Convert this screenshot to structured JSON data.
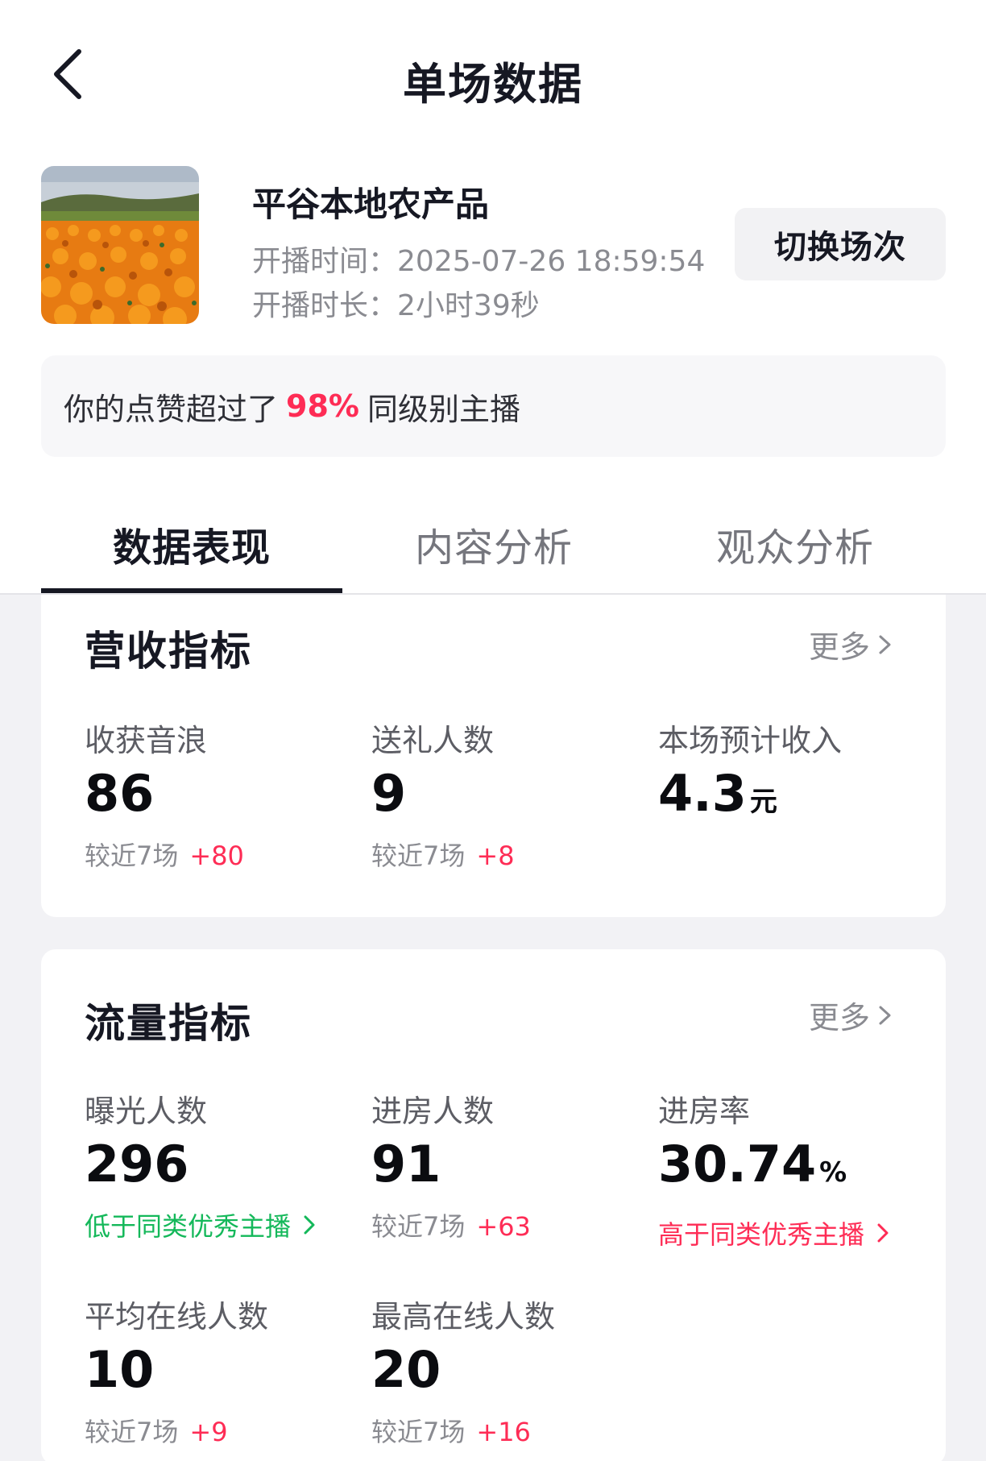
{
  "header": {
    "title": "单场数据",
    "back_icon": "back-arrow-icon"
  },
  "live": {
    "thumbnail_icon": "orange-flower-field-thumbnail",
    "name": "平谷本地农产品",
    "start_time_label": "开播时间：",
    "start_time": "2025-07-26 18:59:54",
    "duration_label": "开播时长：",
    "duration": "2小时39秒",
    "switch_button": "切换场次"
  },
  "likes_banner": {
    "prefix": "你的点赞超过了",
    "percent": "98%",
    "suffix": "同级别主播",
    "accent_color": "#fe2c55"
  },
  "tabs": [
    {
      "label": "数据表现",
      "active": true
    },
    {
      "label": "内容分析",
      "active": false
    },
    {
      "label": "观众分析",
      "active": false
    }
  ],
  "revenue": {
    "title": "营收指标",
    "more": "更多",
    "metrics": [
      {
        "label": "收获音浪",
        "value": "86",
        "compare_label": "较近7场",
        "compare_delta": "+80"
      },
      {
        "label": "送礼人数",
        "value": "9",
        "compare_label": "较近7场",
        "compare_delta": "+8"
      },
      {
        "label": "本场预计收入",
        "value": "4.3",
        "unit": "元"
      }
    ]
  },
  "traffic": {
    "title": "流量指标",
    "more": "更多",
    "metrics": [
      {
        "label": "曝光人数",
        "value": "296",
        "benchmark": "低于同类优秀主播",
        "benchmark_color": "#14b85a"
      },
      {
        "label": "进房人数",
        "value": "91",
        "compare_label": "较近7场",
        "compare_delta": "+63"
      },
      {
        "label": "进房率",
        "value": "30.74",
        "unit": "%",
        "benchmark": "高于同类优秀主播",
        "benchmark_color": "#fe2c55"
      },
      {
        "label": "平均在线人数",
        "value": "10",
        "compare_label": "较近7场",
        "compare_delta": "+9"
      },
      {
        "label": "最高在线人数",
        "value": "20",
        "compare_label": "较近7场",
        "compare_delta": "+16"
      }
    ]
  },
  "colors": {
    "accent_red": "#fe2c55",
    "accent_green": "#14b85a",
    "text_primary": "#161823",
    "text_secondary": "#8a8b91"
  }
}
